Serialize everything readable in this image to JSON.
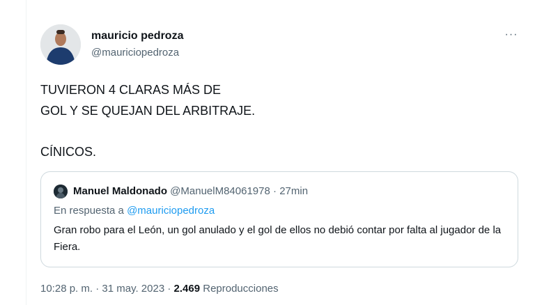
{
  "author": {
    "name": "mauricio pedroza",
    "handle": "@mauriciopedroza"
  },
  "tweet": {
    "lines": [
      "TUVIERON 4 CLARAS MÁS DE",
      "GOL Y SE QUEJAN DEL ARBITRAJE.",
      "CÍNICOS."
    ]
  },
  "quote": {
    "name": "Manuel Maldonado",
    "handle": "@ManuelM84061978",
    "separator": " · ",
    "time": "27min",
    "reply_prefix": "En respuesta a ",
    "reply_to": "@mauriciopedroza",
    "text": "Gran robo para el León, un gol anulado y el gol de ellos no debió contar por falta al jugador de la Fiera."
  },
  "footer": {
    "time": "10:28 p. m.",
    "date": "31 may. 2023",
    "views_count": "2.469",
    "views_label": "Reproducciones"
  },
  "more_label": "···",
  "icons": {
    "more": "more-options-icon"
  }
}
